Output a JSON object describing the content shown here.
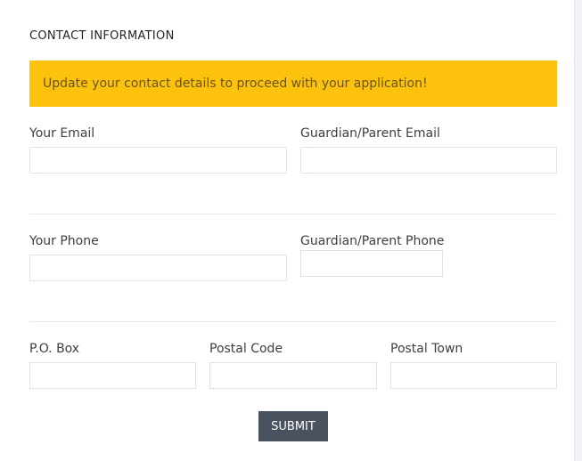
{
  "section": {
    "title": "CONTACT INFORMATION"
  },
  "alert": {
    "text": "Update your contact details to proceed with your application!"
  },
  "fields": {
    "your_email": {
      "label": "Your Email",
      "value": ""
    },
    "guardian_email": {
      "label": "Guardian/Parent Email",
      "value": ""
    },
    "your_phone": {
      "label": "Your Phone",
      "value": ""
    },
    "guardian_phone": {
      "label": "Guardian/Parent Phone",
      "value": ""
    },
    "po_box": {
      "label": "P.O. Box",
      "value": ""
    },
    "postal_code": {
      "label": "Postal Code",
      "value": ""
    },
    "postal_town": {
      "label": "Postal Town",
      "value": ""
    }
  },
  "actions": {
    "submit_label": "SUBMIT"
  },
  "colors": {
    "alert_background": "#fdc20d",
    "submit_background": "#4a5260"
  }
}
